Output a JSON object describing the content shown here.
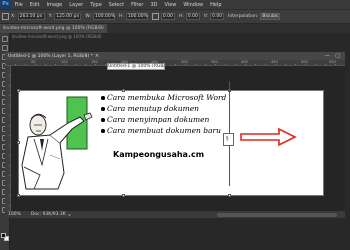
{
  "app": {
    "logo": "Ps"
  },
  "menubar": {
    "items": [
      "File",
      "Edit",
      "Image",
      "Layer",
      "Type",
      "Select",
      "Filter",
      "3D",
      "View",
      "Window",
      "Help"
    ]
  },
  "options": {
    "x_value": "263.50 px",
    "y_value": "125.00 px",
    "w_value": "100.00%",
    "h_value": "100.00%",
    "angle_value": "0.00",
    "h_skew": "0.00",
    "v_skew": "0.00",
    "interpolation_label": "Interpolation:",
    "interpolation_value": "Bicubic"
  },
  "document": {
    "bg_title": "ikvideo-microsoft-word.png @ 100% (RGB/8)",
    "float_tab_title": "Untitled-1 @ 100% (Layer 1, RGB/8) *",
    "float_close": "×",
    "float_controls": "— □"
  },
  "ruler": {
    "numbers": [
      "50",
      "100",
      "150",
      "200",
      "250",
      "300",
      "350",
      "400",
      "450",
      "500",
      "550"
    ]
  },
  "tooltip": "Untitled-1 @ 100% (RGB/8)",
  "canvas_content": {
    "bullets": [
      "Cara membuka Microsoft Word",
      "Cara menutup dokumen",
      "Cara menyimpan dokumen",
      "Cara membuat dokumen baru"
    ],
    "brand": "Kampeongusaha.cm"
  },
  "selection_glyph": "§",
  "status": {
    "zoom": "100%",
    "doc_info": "Doc: 93K/93.3K",
    "arrow": "▸"
  },
  "colors": {
    "accent_red": "#e0261d",
    "green_board": "#4fc24f",
    "ps_blue": "#1c3d63"
  }
}
